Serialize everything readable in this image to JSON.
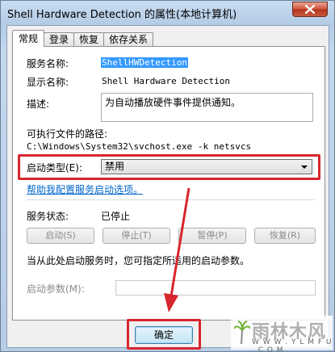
{
  "window": {
    "title": "Shell Hardware Detection 的属性(本地计算机)"
  },
  "tabs": [
    {
      "label": "常规",
      "active": true
    },
    {
      "label": "登录",
      "active": false
    },
    {
      "label": "恢复",
      "active": false
    },
    {
      "label": "依存关系",
      "active": false
    }
  ],
  "general": {
    "service_name_label": "服务名称:",
    "service_name_value": "ShellHWDetection",
    "display_name_label": "显示名称:",
    "display_name_value": "Shell Hardware Detection",
    "description_label": "描述:",
    "description_value": "为自动播放硬件事件提供通知。",
    "exe_path_label": "可执行文件的路径:",
    "exe_path_value": "C:\\Windows\\System32\\svchost.exe -k netsvcs",
    "startup_type_label": "启动类型(E):",
    "startup_type_value": "禁用",
    "help_link": "帮助我配置服务启动选项。",
    "service_status_label": "服务状态:",
    "service_status_value": "已停止",
    "buttons": {
      "start": "启动(S)",
      "stop": "停止(T)",
      "pause": "暂停(P)",
      "resume": "恢复(R)"
    },
    "hint_text": "当从此处启动服务时，您可指定所适用的启动参数。",
    "start_params_label": "启动参数(M):",
    "start_params_value": ""
  },
  "footer": {
    "ok_label": "确定"
  },
  "watermark": {
    "brand": "雨林木风",
    "url": "W W W . Y L M F U . C O M"
  },
  "colors": {
    "highlight": "#d7262e",
    "selection": "#3399ff",
    "link": "#0066cc"
  }
}
